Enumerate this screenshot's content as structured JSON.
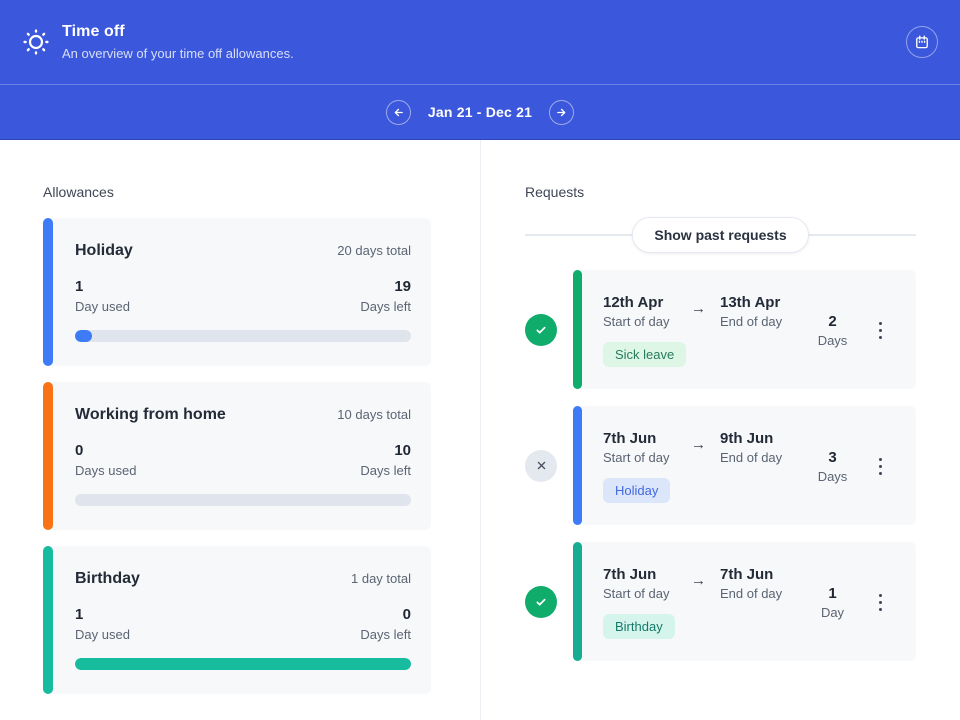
{
  "header": {
    "title": "Time off",
    "subtitle": "An overview of your time off allowances."
  },
  "date_nav": {
    "range": "Jan 21 - Dec 21"
  },
  "allowances": {
    "section_label": "Allowances",
    "cards": [
      {
        "name": "Holiday",
        "total": "20 days total",
        "used_value": "1",
        "used_label": "Day used",
        "left_value": "19",
        "left_label": "Days left",
        "accent": "#3D7BF7",
        "progress_width": "5%"
      },
      {
        "name": "Working from home",
        "total": "10 days total",
        "used_value": "0",
        "used_label": "Days used",
        "left_value": "10",
        "left_label": "Days left",
        "accent": "#F97316",
        "progress_width": "0%"
      },
      {
        "name": "Birthday",
        "total": "1 day total",
        "used_value": "1",
        "used_label": "Day used",
        "left_value": "0",
        "left_label": "Days left",
        "accent": "#17BC9E",
        "progress_width": "100%"
      }
    ]
  },
  "requests": {
    "section_label": "Requests",
    "show_past_button": "Show past requests",
    "items": [
      {
        "status": "approved",
        "start_date": "12th Apr",
        "start_label": "Start of day",
        "end_date": "13th Apr",
        "end_label": "End of day",
        "tag": "Sick leave",
        "tag_bg": "#DDF6E6",
        "tag_color": "#287B58",
        "duration_value": "2",
        "duration_label": "Days",
        "accent": "#10AC6B"
      },
      {
        "status": "declined",
        "start_date": "7th Jun",
        "start_label": "Start of day",
        "end_date": "9th Jun",
        "end_label": "End of day",
        "tag": "Holiday",
        "tag_bg": "#DBE6FB",
        "tag_color": "#4268DF",
        "duration_value": "3",
        "duration_label": "Days",
        "accent": "#3D7BF7"
      },
      {
        "status": "approved",
        "start_date": "7th Jun",
        "start_label": "Start of day",
        "end_date": "7th Jun",
        "end_label": "End of day",
        "tag": "Birthday",
        "tag_bg": "#D5F5EC",
        "tag_color": "#14796A",
        "duration_value": "1",
        "duration_label": "Day",
        "accent": "#17AD93"
      }
    ]
  },
  "colors": {
    "header_blue": "#3B57DB",
    "card_bg": "#F7F8FA",
    "progress_track": "#DFE4ED",
    "approved_green": "#10AC6B",
    "declined_gray": "#E4E8EF"
  }
}
